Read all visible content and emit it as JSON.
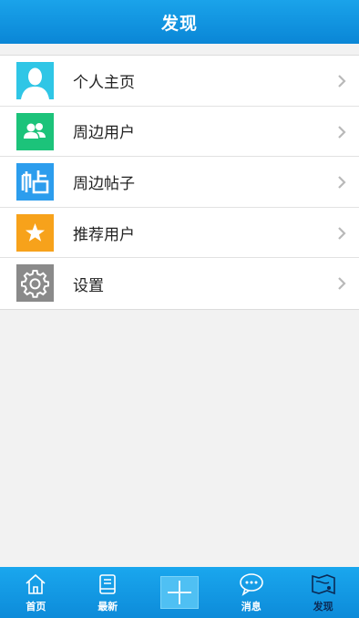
{
  "header": {
    "title": "发现"
  },
  "menu": {
    "items": [
      {
        "label": "个人主页",
        "icon": "person-icon",
        "color": "#2fc6e6"
      },
      {
        "label": "周边用户",
        "icon": "users-icon",
        "color": "#1cc37a"
      },
      {
        "label": "周边帖子",
        "icon": "post-icon",
        "color": "#2c9ded"
      },
      {
        "label": "推荐用户",
        "icon": "star-icon",
        "color": "#f7a21b"
      },
      {
        "label": "设置",
        "icon": "gear-icon",
        "color": "#8a8a8a"
      }
    ]
  },
  "tabbar": {
    "tabs": [
      {
        "label": "首页",
        "icon": "home-icon"
      },
      {
        "label": "最新",
        "icon": "book-icon"
      },
      {
        "label": "",
        "icon": "plus-icon"
      },
      {
        "label": "消息",
        "icon": "chat-icon"
      },
      {
        "label": "发现",
        "icon": "map-icon",
        "active": true
      }
    ]
  }
}
